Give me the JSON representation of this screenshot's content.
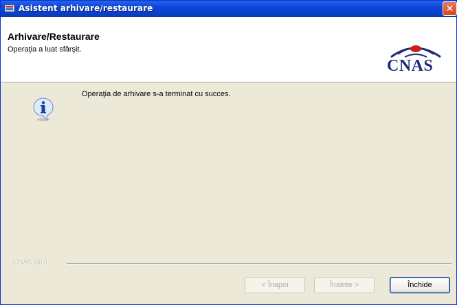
{
  "window": {
    "title": "Asistent arhivare/restaurare",
    "close_glyph": "✕"
  },
  "header": {
    "title": "Arhivare/Restaurare",
    "subtitle": "Operaţia a luat sfârşit."
  },
  "logo": {
    "text": "CNAS",
    "icon": "cnas-logo-icon"
  },
  "content": {
    "icon": "info-icon",
    "message": "Operaţia de arhivare s-a terminat cu succes."
  },
  "footer": {
    "group_label": "CNAS SIUI"
  },
  "buttons": {
    "back": "< Înapoi",
    "next": "Înainte >",
    "close": "Închide"
  },
  "colors": {
    "titlebar": "#0a46d8",
    "background": "#ece9d8",
    "logo_blue": "#1e2a7a",
    "logo_red": "#c81e1e"
  }
}
